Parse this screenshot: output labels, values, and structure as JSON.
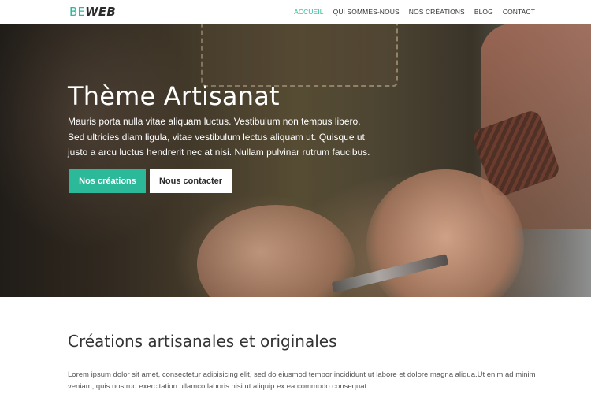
{
  "header": {
    "logo": {
      "part1": "BE",
      "part2": "WEB"
    },
    "nav": [
      {
        "label": "ACCUEIL",
        "active": true
      },
      {
        "label": "QUI SOMMES-NOUS",
        "active": false
      },
      {
        "label": "NOS CRÉATIONS",
        "active": false
      },
      {
        "label": "BLOG",
        "active": false
      },
      {
        "label": "CONTACT",
        "active": false
      }
    ]
  },
  "hero": {
    "title": "Thème Artisanat",
    "text": "Mauris porta nulla vitae aliquam luctus. Vestibulum non tempus libero. Sed ultricies diam ligula, vitae vestibulum lectus aliquam ut. Quisque ut justo a arcu luctus hendrerit nec at nisi. Nullam pulvinar rutrum faucibus.",
    "primary_button": "Nos créations",
    "secondary_button": "Nous contacter"
  },
  "content": {
    "title": "Créations artisanales et originales",
    "text": "Lorem ipsum dolor sit amet, consectetur adipisicing elit, sed do eiusmod tempor incididunt ut labore et dolore magna aliqua.Ut enim ad minim veniam, quis nostrud exercitation ullamco laboris nisi ut aliquip ex ea commodo consequat."
  },
  "colors": {
    "accent": "#2bb99a",
    "text_dark": "#333333",
    "white": "#ffffff"
  }
}
